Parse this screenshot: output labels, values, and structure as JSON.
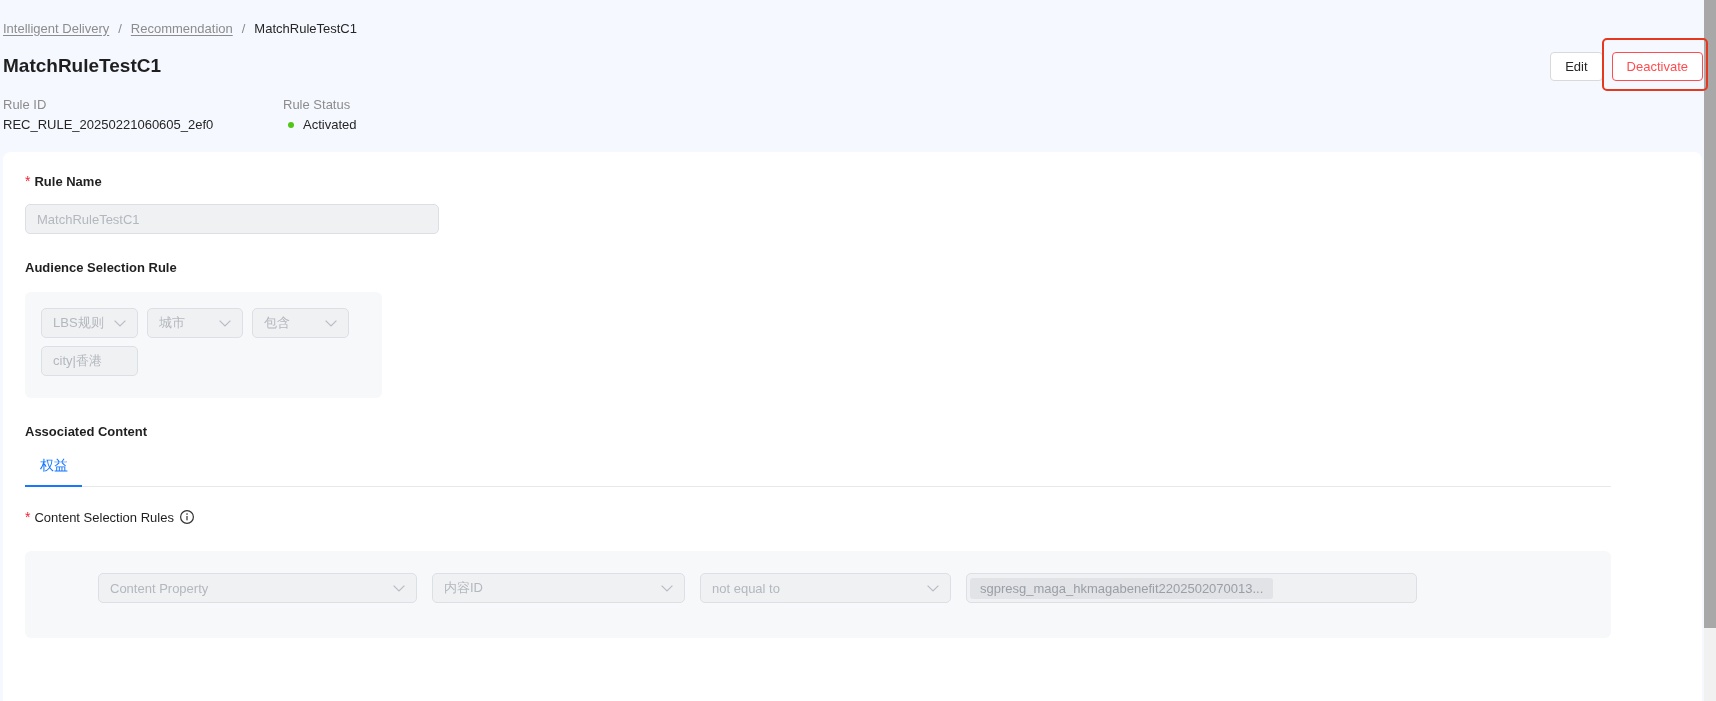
{
  "breadcrumb": [
    {
      "label": "Intelligent Delivery",
      "kind": "link"
    },
    {
      "label": "Recommendation",
      "kind": "link",
      "separator": "/"
    },
    {
      "label": "MatchRuleTestC1",
      "kind": "current",
      "separator": "/"
    }
  ],
  "title": "MatchRuleTestC1",
  "actions": [
    {
      "label": "Edit",
      "kind": "default",
      "highlighted": false
    },
    {
      "label": "Deactivate",
      "kind": "danger",
      "highlighted": true
    }
  ],
  "meta": [
    {
      "label": "Rule ID",
      "kind": "text",
      "value": "REC_RULE_20250221060605_2ef0"
    },
    {
      "label": "Rule Status",
      "kind": "status",
      "value": "Activated",
      "color": "#52c41a"
    }
  ],
  "form": {
    "rule_name": {
      "label": "Rule Name",
      "required_mark": "*",
      "field": {
        "kind": "input",
        "value": "MatchRuleTestC1",
        "disabled": true
      }
    },
    "audience_rule": {
      "label": "Audience Selection Rule",
      "fields": [
        {
          "kind": "select",
          "value": "LBS规则",
          "disabled": true
        },
        {
          "kind": "select",
          "value": "城市",
          "disabled": true
        },
        {
          "kind": "select",
          "value": "包含",
          "disabled": true
        },
        {
          "kind": "input",
          "value": "city|香港",
          "disabled": true
        }
      ]
    },
    "associated_content": {
      "label": "Associated Content",
      "tabs": [
        {
          "label": "权益",
          "selected": true
        }
      ]
    },
    "content_rules": {
      "label": "Content Selection Rules",
      "required_mark": "*",
      "info": true,
      "fields": [
        {
          "kind": "select",
          "value": "Content Property",
          "disabled": true
        },
        {
          "kind": "select",
          "value": "内容ID",
          "disabled": true
        },
        {
          "kind": "select",
          "value": "not equal to",
          "disabled": true
        },
        {
          "kind": "tags",
          "tags": [
            "sgpresg_maga_hkmagabenefit2202502070013..."
          ],
          "disabled": true
        }
      ]
    }
  }
}
